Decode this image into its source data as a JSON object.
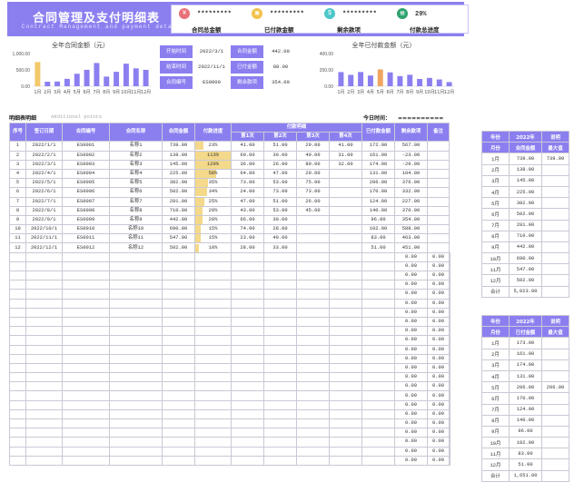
{
  "header": {
    "title": "合同管理及支付明细表",
    "subtitle": "Contract Management and payment details",
    "kpis": [
      {
        "value": "*********",
        "label": "合同总金额",
        "icon": "money-icon",
        "color": "#e9707a"
      },
      {
        "value": "*********",
        "label": "已付款金额",
        "icon": "wallet-icon",
        "color": "#f2c24c"
      },
      {
        "value": "*********",
        "label": "剩余款项",
        "icon": "cash-icon",
        "color": "#4cc6c9"
      },
      {
        "value": "29%",
        "label": "付款总进度",
        "icon": "chart-icon",
        "color": "#2fa36f"
      }
    ]
  },
  "charts": {
    "left": {
      "title": "全年合同金额（元）",
      "yticks": [
        "1,000.00",
        "500.00",
        "0.00"
      ],
      "ylim": [
        0,
        1000
      ],
      "categories": [
        "1月",
        "2月",
        "3月",
        "4月",
        "5月",
        "6月",
        "7月",
        "8月",
        "9月",
        "10月",
        "11月",
        "12月"
      ],
      "values": [
        739,
        138,
        145,
        225,
        382,
        502,
        710,
        295,
        442,
        690,
        547,
        502
      ],
      "highlight_index": 0
    },
    "right": {
      "title": "全年已付款金额（元）",
      "yticks": [
        "400.00",
        "200.00",
        "0.00"
      ],
      "ylim": [
        0,
        400
      ],
      "categories": [
        "1月",
        "2月",
        "3月",
        "4月",
        "5月",
        "6月",
        "7月",
        "8月",
        "9月",
        "10月",
        "11月",
        "12月"
      ],
      "values": [
        173,
        139,
        174,
        131,
        206,
        170,
        124,
        140,
        89,
        102,
        83,
        51
      ],
      "highlight_index": 4
    }
  },
  "info": {
    "rows": [
      {
        "k1": "开始时间",
        "v1": "2022/3/1",
        "k2": "合同金额",
        "v2": "442.00"
      },
      {
        "k1": "结束时间",
        "v1": "2022/11/1",
        "k2": "已付金额",
        "v2": "88.00"
      },
      {
        "k1": "合同编号",
        "v1": "ES0009",
        "k2": "剩余款项",
        "v2": "354.00"
      }
    ]
  },
  "section": {
    "label": "明细表明细",
    "hint": "Additional points",
    "update_label": "今日时间：",
    "update_value": "=========="
  },
  "table": {
    "headers": {
      "seq": "序号",
      "date": "签订日期",
      "no": "合同编号",
      "name": "合同名称",
      "amount": "合同金额",
      "progress": "付款进度",
      "payments": "付款明细",
      "p1": "第1次",
      "p2": "第2次",
      "p3": "第3次",
      "p4": "第4次",
      "paid": "已付款金额",
      "remain": "剩余款项",
      "note": "备注"
    },
    "rows": [
      [
        "1",
        "2022/1/1",
        "ES0001",
        "名称1",
        "739.00",
        "23%",
        0.23,
        "41.00",
        "51.00",
        "29.00",
        "41.00",
        "172.00",
        "567.00"
      ],
      [
        "2",
        "2022/2/1",
        "ES0002",
        "名称2",
        "138.00",
        "113%",
        1.0,
        "60.00",
        "30.00",
        "40.00",
        "31.00",
        "161.00",
        "-23.00"
      ],
      [
        "3",
        "2022/3/1",
        "ES0003",
        "名称3",
        "145.00",
        "120%",
        1.0,
        "36.00",
        "26.00",
        "80.00",
        "32.00",
        "174.00",
        "-29.00"
      ],
      [
        "4",
        "2022/4/1",
        "ES0004",
        "名称4",
        "225.00",
        "58%",
        0.58,
        "64.00",
        "47.00",
        "20.00",
        "",
        "131.00",
        "104.00"
      ],
      [
        "5",
        "2022/5/1",
        "ES0005",
        "名称5",
        "382.00",
        "35%",
        0.35,
        "73.00",
        "53.00",
        "75.00",
        "",
        "206.00",
        "376.00"
      ],
      [
        "6",
        "2022/6/1",
        "ES0006",
        "名称6",
        "502.00",
        "34%",
        0.34,
        "24.00",
        "73.00",
        "73.00",
        "",
        "170.00",
        "332.00"
      ],
      [
        "7",
        "2022/7/1",
        "ES0007",
        "名称7",
        "281.00",
        "25%",
        0.25,
        "47.00",
        "51.00",
        "26.00",
        "",
        "124.00",
        "227.00"
      ],
      [
        "8",
        "2022/8/1",
        "ES0008",
        "名称8",
        "710.00",
        "20%",
        0.2,
        "43.00",
        "53.00",
        "45.00",
        "",
        "140.00",
        "370.00"
      ],
      [
        "9",
        "2022/9/1",
        "ES0009",
        "名称9",
        "442.00",
        "20%",
        0.2,
        "66.00",
        "30.00",
        "",
        "",
        "96.00",
        "354.00"
      ],
      [
        "10",
        "2022/10/1",
        "ES0010",
        "名称10",
        "690.00",
        "15%",
        0.15,
        "74.00",
        "28.00",
        "",
        "",
        "102.00",
        "588.00"
      ],
      [
        "11",
        "2022/11/1",
        "ES0011",
        "名称11",
        "547.00",
        "15%",
        0.15,
        "23.00",
        "49.00",
        "",
        "",
        "83.00",
        "463.00"
      ],
      [
        "12",
        "2022/12/1",
        "ES0012",
        "名称12",
        "502.00",
        "10%",
        0.1,
        "28.00",
        "33.00",
        "",
        "",
        "51.00",
        "451.00"
      ]
    ],
    "empty_rows": 23,
    "empty_paid": "0.00",
    "empty_remain": "0.00"
  },
  "side2022": {
    "header": [
      "年份",
      "2022年",
      "说明"
    ],
    "subheader": [
      "月份",
      "合同金额",
      "最大值"
    ],
    "rows": [
      [
        "1月",
        "739.00",
        "739.00"
      ],
      [
        "2月",
        "138.00",
        ""
      ],
      [
        "3月",
        "145.00",
        ""
      ],
      [
        "4月",
        "225.00",
        ""
      ],
      [
        "5月",
        "382.00",
        ""
      ],
      [
        "6月",
        "502.00",
        ""
      ],
      [
        "7月",
        "281.00",
        ""
      ],
      [
        "8月",
        "710.00",
        ""
      ],
      [
        "9月",
        "442.00",
        ""
      ],
      [
        "10月",
        "690.00",
        ""
      ],
      [
        "11月",
        "547.00",
        ""
      ],
      [
        "12月",
        "502.00",
        ""
      ]
    ],
    "total": [
      "合计",
      "5,023.00",
      ""
    ]
  },
  "side2022b": {
    "header": [
      "年份",
      "2022年",
      "说明"
    ],
    "subheader": [
      "月份",
      "已付金额",
      "最大值"
    ],
    "rows": [
      [
        "1月",
        "173.00",
        ""
      ],
      [
        "2月",
        "161.00",
        ""
      ],
      [
        "3月",
        "174.00",
        ""
      ],
      [
        "4月",
        "131.00",
        ""
      ],
      [
        "5月",
        "206.00",
        "206.00"
      ],
      [
        "6月",
        "170.00",
        ""
      ],
      [
        "7月",
        "124.00",
        ""
      ],
      [
        "8月",
        "140.00",
        ""
      ],
      [
        "9月",
        "96.00",
        ""
      ],
      [
        "10月",
        "102.00",
        ""
      ],
      [
        "11月",
        "83.00",
        ""
      ],
      [
        "12月",
        "51.00",
        ""
      ]
    ],
    "total": [
      "合计",
      "1,651.00",
      ""
    ]
  }
}
